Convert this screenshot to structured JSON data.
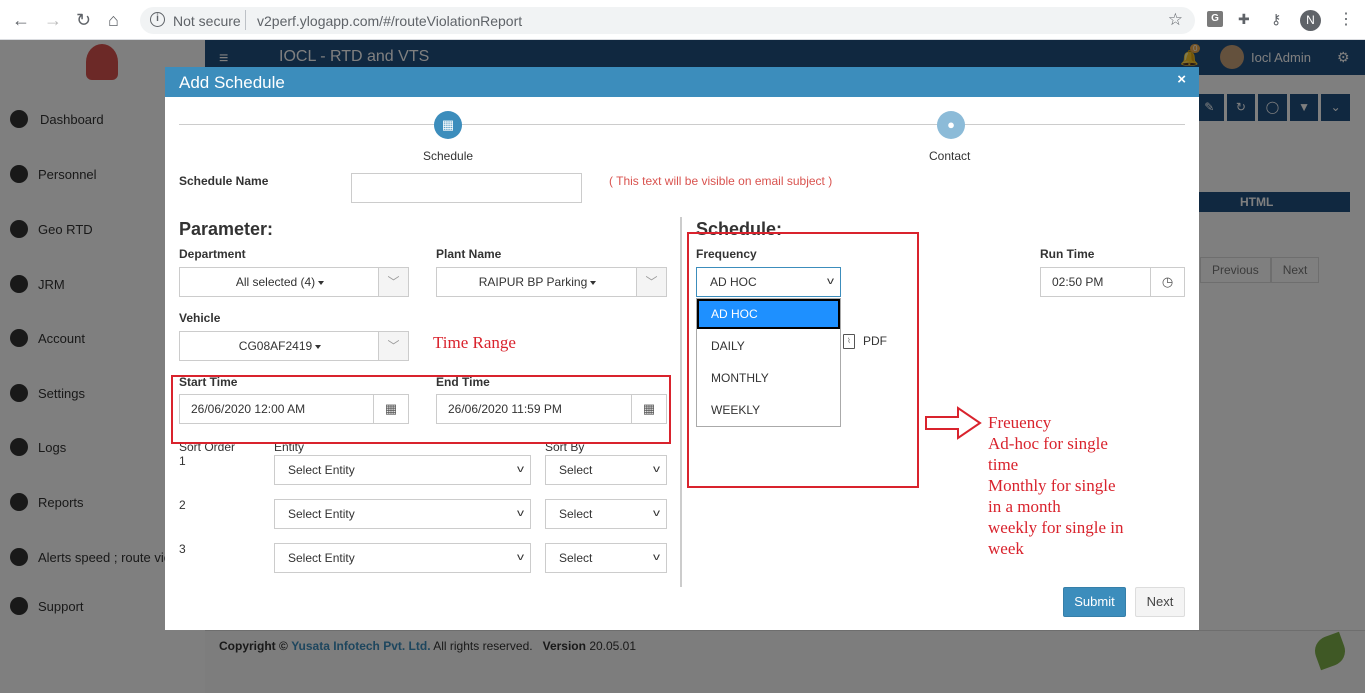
{
  "browser": {
    "not_secure": "Not secure",
    "url": "v2perf.ylogapp.com/#/routeViolationReport",
    "profile_initial": "N",
    "ext_g": "G"
  },
  "app": {
    "title": "IOCL - RTD and VTS",
    "notif_count": "0",
    "user": "Iocl Admin",
    "sidebar": [
      {
        "label": "Dashboard",
        "icon": "dashboard-icon"
      },
      {
        "label": "Personnel",
        "icon": "personnel-icon"
      },
      {
        "label": "Geo RTD",
        "icon": "map-pin-icon"
      },
      {
        "label": "JRM",
        "icon": "jrm-icon"
      },
      {
        "label": "Account",
        "icon": "thermometer-icon"
      },
      {
        "label": "Settings",
        "icon": "gear-icon"
      },
      {
        "label": "Logs",
        "icon": "clock-icon"
      },
      {
        "label": "Reports",
        "icon": "report-icon"
      },
      {
        "label": "Alerts speed ; route vic",
        "icon": "bell-icon"
      },
      {
        "label": "Support",
        "icon": "link-icon"
      }
    ],
    "html_export": "HTML",
    "pager": {
      "previous": "Previous",
      "next": "Next"
    },
    "footer": {
      "copyright": "Copyright ©",
      "company": "Yusata Infotech Pvt. Ltd.",
      "rights": "All rights reserved.",
      "version_label": "Version",
      "version": "20.05.01"
    }
  },
  "modal": {
    "title": "Add Schedule",
    "close": "×",
    "steps": [
      {
        "label": "Schedule",
        "icon": "calendar-icon"
      },
      {
        "label": "Contact",
        "icon": "users-icon"
      }
    ],
    "schedule_name_label": "Schedule Name",
    "schedule_name_value": "",
    "schedule_name_note": "( This text will be visible on email subject )",
    "parameter_title": "Parameter:",
    "department_label": "Department",
    "department_value": "All selected (4)",
    "plant_label": "Plant Name",
    "plant_value": "RAIPUR BP Parking",
    "vehicle_label": "Vehicle",
    "vehicle_value": "CG08AF2419",
    "start_label": "Start Time",
    "start_value": "26/06/2020 12:00 AM",
    "end_label": "End Time",
    "end_value": "26/06/2020 11:59 PM",
    "sort_order_label": "Sort Order",
    "entity_label": "Entity",
    "sort_by_label": "Sort By",
    "sort_rows": [
      {
        "order": "1",
        "entity": "Select Entity",
        "sort": "Select"
      },
      {
        "order": "2",
        "entity": "Select Entity",
        "sort": "Select"
      },
      {
        "order": "3",
        "entity": "Select Entity",
        "sort": "Select"
      }
    ],
    "schedule_title": "Schedule:",
    "frequency_label": "Frequency",
    "frequency_value": "AD HOC",
    "frequency_options": [
      "AD HOC",
      "DAILY",
      "MONTHLY",
      "WEEKLY"
    ],
    "pdf_label": "PDF",
    "run_time_label": "Run Time",
    "run_time_value": "02:50 PM",
    "submit": "Submit",
    "next": "Next"
  },
  "annotations": {
    "time_range": "Time Range",
    "frequency_note": [
      "Freuency",
      "Ad-hoc for single",
      "time",
      "Monthly for single",
      "in a month",
      "weekly for single in",
      "week"
    ]
  },
  "colors": {
    "primary": "#3c8dbc",
    "app_header": "#205081",
    "annotation": "#d9232d",
    "note": "#d9534f"
  }
}
